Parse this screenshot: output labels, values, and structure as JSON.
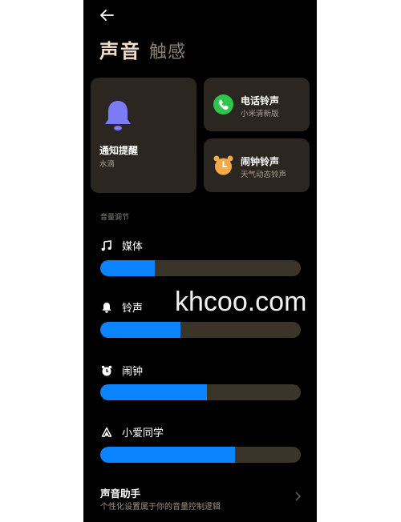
{
  "header": {
    "tab_sound": "声音",
    "tab_haptics": "触感"
  },
  "cards": {
    "notification": {
      "title": "通知提醒",
      "subtitle": "水滴"
    },
    "ringtone": {
      "title": "电话铃声",
      "subtitle": "小米清新版"
    },
    "alarm": {
      "title": "闹钟铃声",
      "subtitle": "天气动态铃声"
    }
  },
  "volume": {
    "section_label": "音量调节",
    "rows": [
      {
        "label": "媒体",
        "icon": "music-note-icon",
        "level": 0.27
      },
      {
        "label": "铃声",
        "icon": "bell-icon",
        "level": 0.4
      },
      {
        "label": "闹钟",
        "icon": "alarm-clock-icon",
        "level": 0.53
      },
      {
        "label": "小爱同学",
        "icon": "xiaoai-icon",
        "level": 0.67
      }
    ]
  },
  "assistant": {
    "title": "声音助手",
    "subtitle": "个性化设置属于你的音量控制逻辑"
  },
  "watermark": "khcoo.com",
  "colors": {
    "background": "#000000",
    "card": "#2b2620",
    "accent_blue": "#0d84ff",
    "bell_purple": "#7b7cf5",
    "phone_green": "#2fc54d",
    "alarm_orange": "#f4a94a",
    "title_text": "#f0dfc4"
  }
}
